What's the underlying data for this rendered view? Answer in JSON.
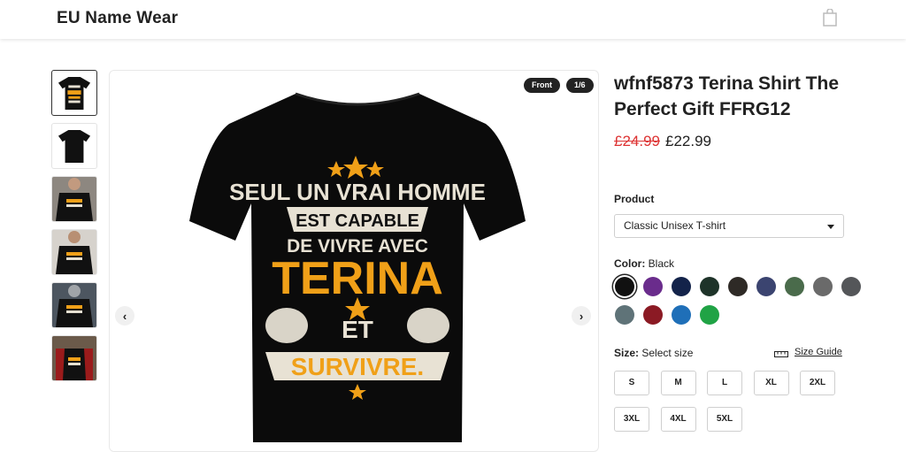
{
  "header": {
    "brand": "EU Name Wear",
    "cart_icon": "shopping-bag-icon"
  },
  "gallery": {
    "front_label": "Front",
    "counter": "1/6",
    "prev_icon": "chevron-left-icon",
    "next_icon": "chevron-right-icon",
    "thumbnails": [
      "front",
      "back",
      "model-front",
      "model-front-2",
      "model-side",
      "model-plaid"
    ],
    "print_lines": [
      "SEUL UN VRAI HOMME",
      "EST CAPABLE",
      "DE VIVRE AVEC",
      "TERINA",
      "ET",
      "SURVIVRE."
    ]
  },
  "product": {
    "title": "wfnf5873 Terina Shirt The Perfect Gift FFRG12",
    "old_price": "£24.99",
    "price": "£22.99",
    "product_label": "Product",
    "product_value": "Classic Unisex T-shirt",
    "color_label": "Color:",
    "color_value": "Black",
    "colors": [
      "#111111",
      "#6a2c8c",
      "#13234a",
      "#1e3329",
      "#2e2a26",
      "#3b4470",
      "#4a6b4b",
      "#6a6a6a",
      "#545659",
      "#5f7378",
      "#8b1a24",
      "#1f6fb8",
      "#20a345"
    ],
    "size_label": "Size:",
    "size_value": "Select size",
    "size_guide": "Size Guide",
    "sizes": [
      "S",
      "M",
      "L",
      "XL",
      "2XL",
      "3XL",
      "4XL",
      "5XL"
    ]
  }
}
